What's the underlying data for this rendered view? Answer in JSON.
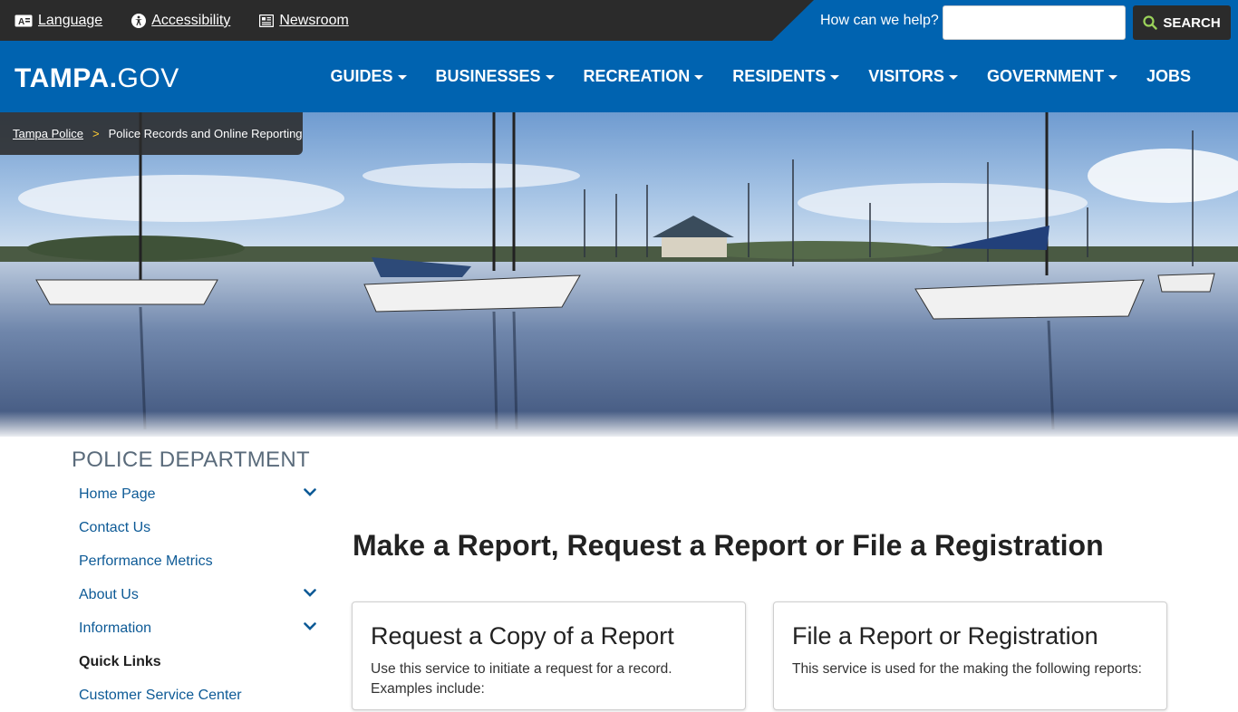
{
  "utility": {
    "language": "Language",
    "accessibility": "Accessibility",
    "newsroom": "Newsroom"
  },
  "search": {
    "prompt": "How can we help?",
    "placeholder": "",
    "button_label": "SEARCH"
  },
  "brand": {
    "logo_bold": "TAMPA.",
    "logo_light": "GOV"
  },
  "nav": {
    "items": [
      {
        "label": "GUIDES",
        "has_dropdown": true
      },
      {
        "label": "BUSINESSES",
        "has_dropdown": true
      },
      {
        "label": "RECREATION",
        "has_dropdown": true
      },
      {
        "label": "RESIDENTS",
        "has_dropdown": true
      },
      {
        "label": "VISITORS",
        "has_dropdown": true
      },
      {
        "label": "GOVERNMENT",
        "has_dropdown": true
      },
      {
        "label": "JOBS",
        "has_dropdown": false
      }
    ]
  },
  "breadcrumb": {
    "parent": "Tampa Police",
    "separator": ">",
    "current": "Police Records and Online Reporting"
  },
  "sidebar": {
    "title": "POLICE DEPARTMENT",
    "items": [
      {
        "label": "Home Page",
        "expandable": true
      },
      {
        "label": "Contact Us",
        "expandable": false
      },
      {
        "label": "Performance Metrics",
        "expandable": false
      },
      {
        "label": "About Us",
        "expandable": true
      },
      {
        "label": "Information",
        "expandable": true
      },
      {
        "label": "Quick Links",
        "expandable": false
      },
      {
        "label": "Customer Service Center",
        "expandable": false
      }
    ]
  },
  "main": {
    "heading": "Make a Report, Request a Report or File a Registration",
    "cards": [
      {
        "title": "Request a Copy of a Report",
        "text": "Use this service to initiate a request for a record. Examples include:"
      },
      {
        "title": "File a Report or Registration",
        "text": "This service is used for the making the following reports:"
      }
    ]
  },
  "colors": {
    "brand_blue": "#0063b0",
    "dark_bar": "#2b2b2b",
    "link_blue": "#0d5a96",
    "accent_yellow": "#ffcc33",
    "search_icon_green": "#9bd35a"
  }
}
